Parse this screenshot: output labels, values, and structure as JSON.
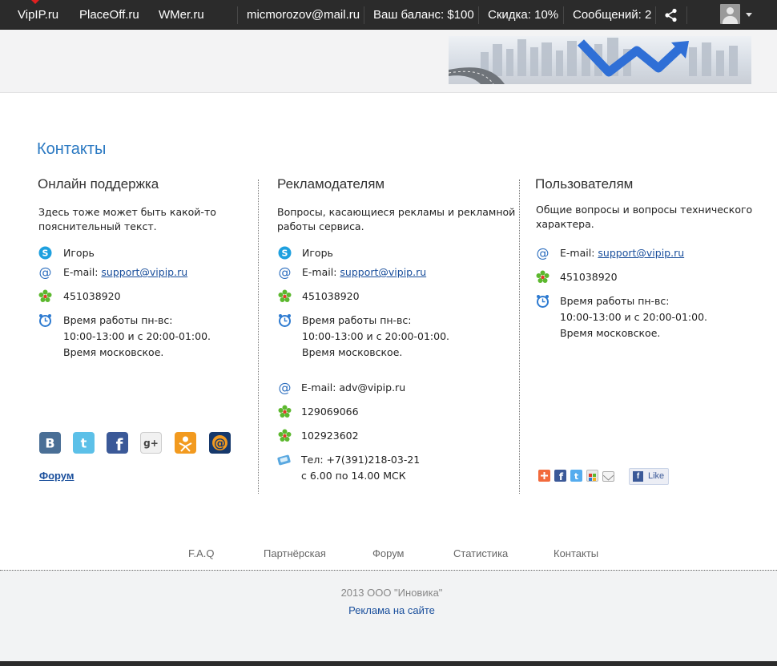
{
  "topbar": {
    "sites": [
      "VipIP.ru",
      "PlaceOff.ru",
      "WMer.ru"
    ],
    "email": "micmorozov@mail.ru",
    "balance": "Ваш баланс: $100",
    "discount": "Скидка: 10%",
    "messages": "Сообщений: 2",
    "share_icon": "share-icon",
    "avatar_icon": "user-avatar-icon"
  },
  "page": {
    "title": "Контакты"
  },
  "support": {
    "heading": "Онлайн поддержка",
    "desc_line1": "Здесь тоже может быть какой-то",
    "desc_line2": "пояснительный текст.",
    "skype": "Игорь",
    "email_label": "E-mail:",
    "email": "support@vipip.ru",
    "icq": "451038920",
    "hours_line1": "Время работы пн-вс:",
    "hours_line2": "10:00-13:00 и с 20:00-01:00.",
    "hours_line3": "Время московское.",
    "forum": "Форум"
  },
  "advertisers": {
    "heading": "Рекламодателям",
    "desc_line1": "Вопросы, касающиеся рекламы и рекламной",
    "desc_line2": "работы сервиса.",
    "skype": "Игорь",
    "email_label": "E-mail:",
    "email": "support@vipip.ru",
    "icq": "451038920",
    "hours_line1": "Время работы пн-вс:",
    "hours_line2": "10:00-13:00 и с 20:00-01:00.",
    "hours_line3": "Время московское.",
    "adv_email": "E-mail: adv@vipip.ru",
    "icq2": "129069066",
    "icq3": "102923602",
    "phone_line1": "Тел: +7(391)218-03-21",
    "phone_line2": "с 6.00 по 14.00 МСК"
  },
  "users": {
    "heading": "Пользователям",
    "desc_line1": "Общие вопросы и вопросы технического",
    "desc_line2": "характера.",
    "email_label": "E-mail:",
    "email": "support@vipip.ru",
    "icq": "451038920",
    "hours_line1": "Время работы пн-вс:",
    "hours_line2": "10:00-13:00 и с 20:00-01:00.",
    "hours_line3": "Время московское.",
    "like": "Like"
  },
  "footer": {
    "nav": [
      "F.A.Q",
      "Партнёрская",
      "Форум",
      "Статистика",
      "Контакты"
    ],
    "copyright": "2013 ООО \"Иновика\"",
    "ads": "Реклама на сайте"
  },
  "colors": {
    "topbar": "#2b2b2b",
    "link": "#1a4f9c",
    "title": "#2b79c2",
    "footer_bg": "#f2f3f4"
  }
}
